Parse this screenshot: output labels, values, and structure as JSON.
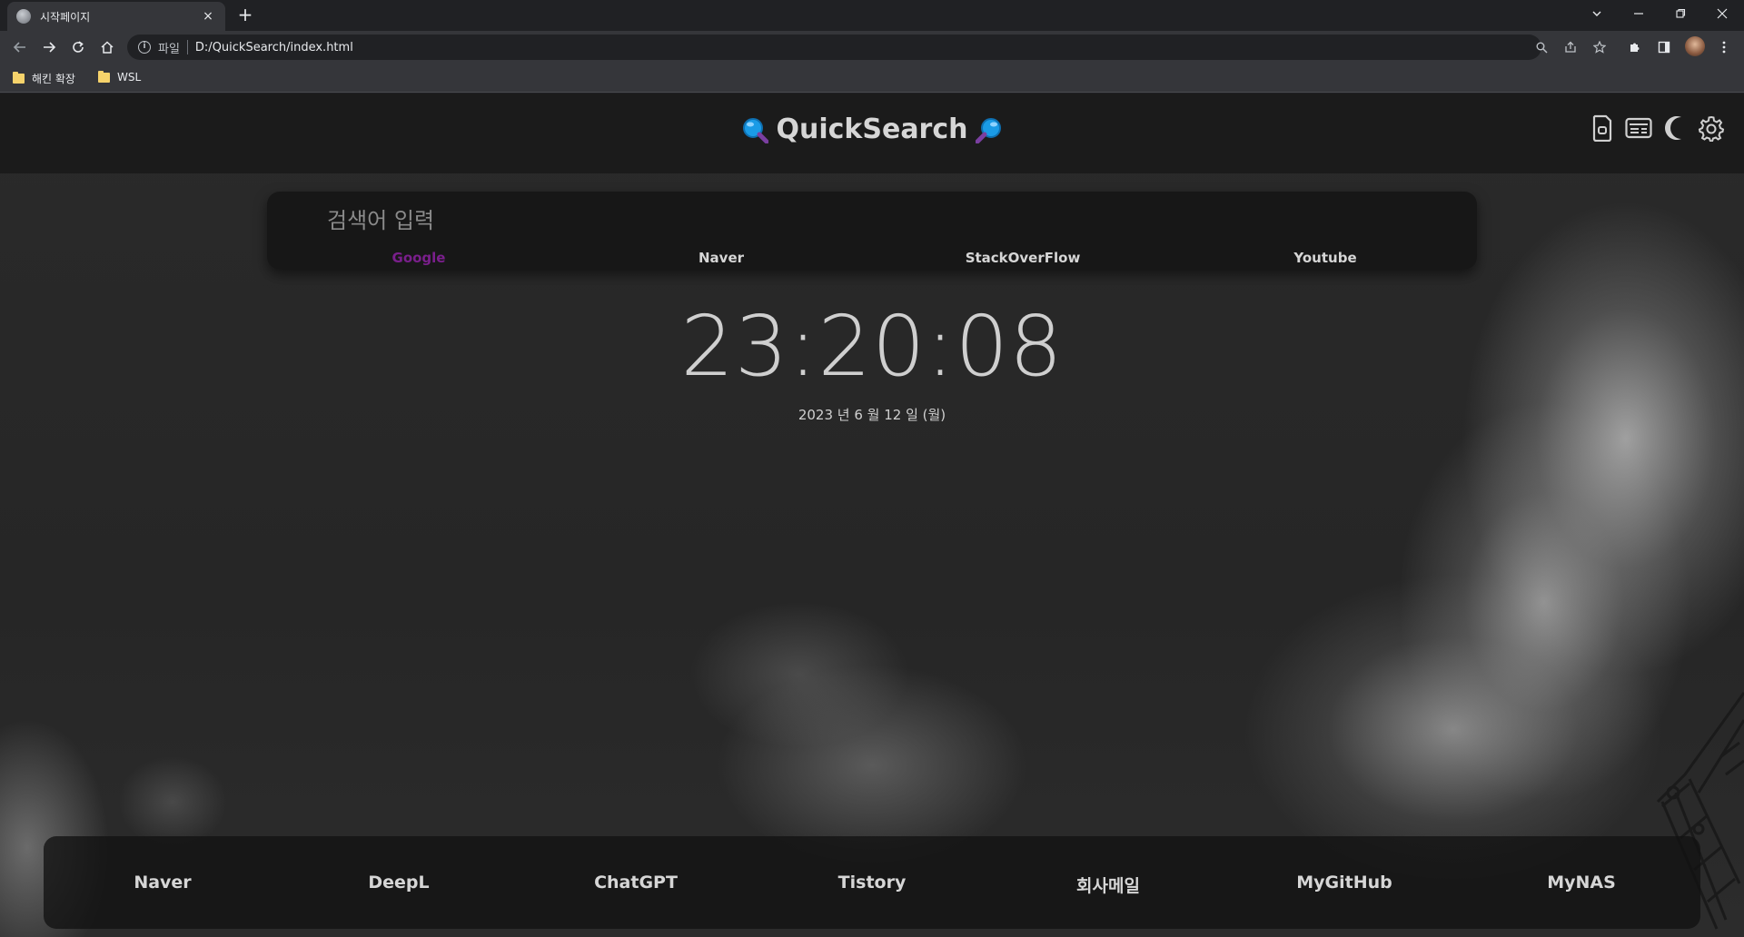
{
  "browser": {
    "tab": {
      "title": "시작페이지",
      "close": "×"
    },
    "new_tab": "+",
    "address": {
      "scheme": "파일",
      "url": "D:/QuickSearch/index.html"
    },
    "bookmarks": [
      {
        "label": "해킨 확장"
      },
      {
        "label": "WSL"
      }
    ]
  },
  "page": {
    "title": "QuickSearch",
    "search": {
      "placeholder": "검색어 입력",
      "value": "",
      "engines": [
        {
          "label": "Google",
          "active": true
        },
        {
          "label": "Naver"
        },
        {
          "label": "StackOverFlow"
        },
        {
          "label": "Youtube"
        }
      ]
    },
    "clock": {
      "time": "23:20:08",
      "date": "2023 년 6 월 12 일 (월)"
    },
    "quick_links": [
      "Naver",
      "DeepL",
      "ChatGPT",
      "Tistory",
      "회사메일",
      "MyGitHub",
      "MyNAS"
    ],
    "header_icons": [
      "sd-card-icon",
      "news-icon",
      "moon-icon",
      "gear-icon"
    ],
    "colors": {
      "accent_active_engine": "#7a1f8c",
      "magnifier_blue": "#1a9be6"
    }
  }
}
